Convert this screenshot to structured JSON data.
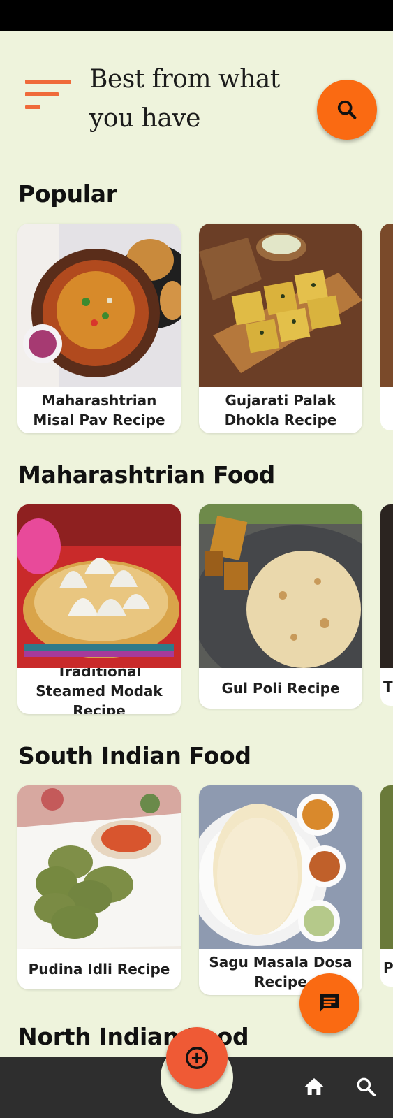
{
  "app": {
    "title": "Best from what you have"
  },
  "sections": [
    {
      "title": "Popular",
      "cards": [
        {
          "label": "Maharashtrian Misal Pav Recipe",
          "image": "misal-pav-photo"
        },
        {
          "label": "Gujarati Palak Dhokla Recipe",
          "image": "palak-dhokla-photo"
        }
      ]
    },
    {
      "title": "Maharashtrian Food",
      "cards": [
        {
          "label": "Traditional Steamed Modak Recipe",
          "image": "modak-photo"
        },
        {
          "label": "Gul Poli Recipe",
          "image": "gul-poli-photo"
        }
      ],
      "peek_label_fragment": "T"
    },
    {
      "title": "South Indian Food",
      "cards": [
        {
          "label": "Pudina Idli Recipe",
          "image": "pudina-idli-photo"
        },
        {
          "label": "Sagu Masala Dosa Recipe",
          "image": "masala-dosa-photo"
        }
      ],
      "peek_label_fragment": "P"
    },
    {
      "title": "North Indian Food"
    }
  ],
  "icons": {
    "menu": "menu-icon",
    "search": "search-icon",
    "chat": "chat-icon",
    "add": "add-circle-icon",
    "home": "home-icon",
    "nav_search": "search-icon"
  },
  "colors": {
    "background": "#eef3dc",
    "accent": "#fa6a12",
    "bottom_bar": "#2e2e2e"
  }
}
